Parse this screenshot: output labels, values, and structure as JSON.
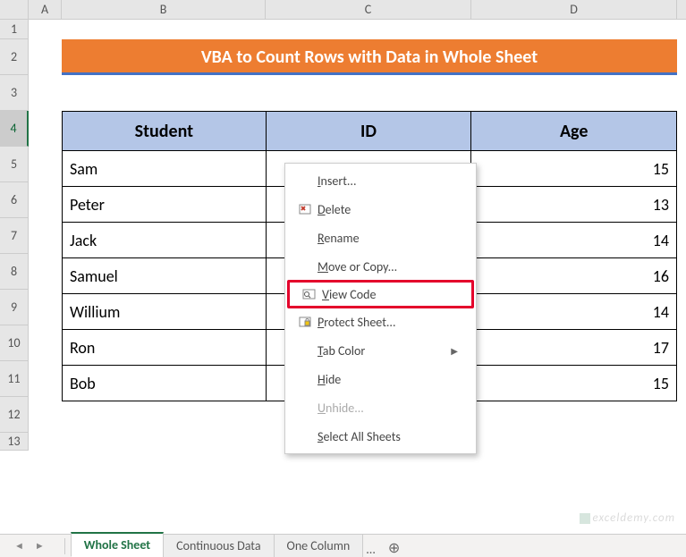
{
  "columns": [
    "A",
    "B",
    "C",
    "D"
  ],
  "rows": [
    "1",
    "2",
    "3",
    "4",
    "5",
    "6",
    "7",
    "8",
    "9",
    "10",
    "11",
    "12",
    "13"
  ],
  "selected_row": "4",
  "title": "VBA to Count Rows with Data in Whole Sheet",
  "table": {
    "headers": [
      "Student",
      "ID",
      "Age"
    ],
    "data": [
      {
        "student": "Sam",
        "age": "15"
      },
      {
        "student": "Peter",
        "age": "13"
      },
      {
        "student": "Jack",
        "age": "14"
      },
      {
        "student": "Samuel",
        "age": "16"
      },
      {
        "student": "Willium",
        "age": "14"
      },
      {
        "student": "Ron",
        "age": "17"
      },
      {
        "student": "Bob",
        "age": "15"
      }
    ]
  },
  "context_menu": {
    "insert": "Insert...",
    "delete": "Delete",
    "rename": "Rename",
    "move_copy": "Move or Copy...",
    "view_code": "View Code",
    "protect": "Protect Sheet...",
    "tab_color": "Tab Color",
    "hide": "Hide",
    "unhide": "Unhide...",
    "select_all": "Select All Sheets"
  },
  "tabs": {
    "active": "Whole Sheet",
    "tab2": "Continuous Data",
    "tab3": "One Column",
    "more": "..."
  },
  "watermark": "exceldemy.com"
}
